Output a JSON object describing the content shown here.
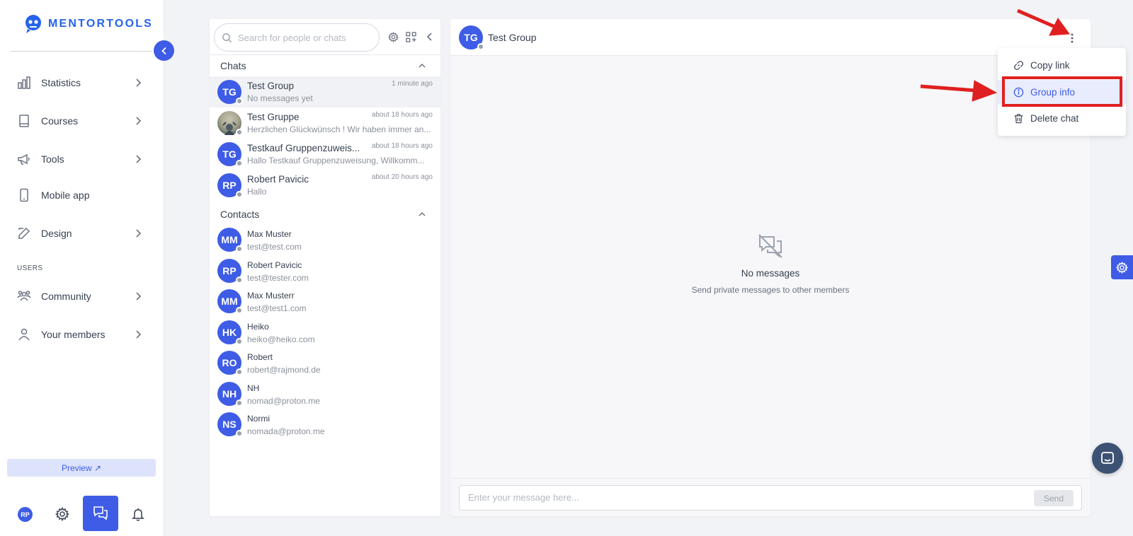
{
  "app": {
    "brand": "MENTORTOOLS"
  },
  "sidebar": {
    "items": [
      {
        "label": "Statistics",
        "icon": "bar-chart-icon"
      },
      {
        "label": "Courses",
        "icon": "book-icon"
      },
      {
        "label": "Tools",
        "icon": "megaphone-icon"
      },
      {
        "label": "Mobile app",
        "icon": "phone-icon"
      },
      {
        "label": "Design",
        "icon": "pencil-icon"
      }
    ],
    "users_section": "USERS",
    "user_items": [
      {
        "label": "Community",
        "icon": "people-icon"
      },
      {
        "label": "Your members",
        "icon": "user-icon"
      }
    ],
    "preview_label": "Preview ↗",
    "user_initials": "RP"
  },
  "chat_list": {
    "search_placeholder": "Search for people or chats",
    "chats_header": "Chats",
    "contacts_header": "Contacts",
    "chats": [
      {
        "initials": "TG",
        "name": "Test Group",
        "preview": "No messages yet",
        "time": "1 minute ago"
      },
      {
        "initials": "",
        "name": "Test Gruppe",
        "preview": "Herzlichen Glückwünsch ! Wir haben immer an...",
        "time": "about 18 hours ago"
      },
      {
        "initials": "TG",
        "name": "Testkauf Gruppenzuweis...",
        "preview": "Hallo Testkauf Gruppenzuweisung, Willkomm...",
        "time": "about 18 hours ago"
      },
      {
        "initials": "RP",
        "name": "Robert Pavicic",
        "preview": "Hallo",
        "time": "about 20 hours ago"
      }
    ],
    "contacts": [
      {
        "initials": "MM",
        "name": "Max Muster",
        "email": "test@test.com"
      },
      {
        "initials": "RP",
        "name": "Robert Pavicic",
        "email": "test@tester.com"
      },
      {
        "initials": "MM",
        "name": "Max Musterr",
        "email": "test@test1.com"
      },
      {
        "initials": "HK",
        "name": "Heiko",
        "email": "heiko@heiko.com"
      },
      {
        "initials": "RO",
        "name": "Robert",
        "email": "robert@rajmond.de"
      },
      {
        "initials": "NH",
        "name": "NH",
        "email": "nomad@proton.me"
      },
      {
        "initials": "NS",
        "name": "Normi",
        "email": "nomada@proton.me"
      }
    ]
  },
  "conversation": {
    "initials": "TG",
    "title": "Test Group",
    "empty_title": "No messages",
    "empty_subtitle": "Send private messages to other members",
    "input_placeholder": "Enter your message here...",
    "send_label": "Send"
  },
  "menu": {
    "items": [
      {
        "label": "Copy link",
        "icon": "link-icon"
      },
      {
        "label": "Group info",
        "icon": "info-icon"
      },
      {
        "label": "Delete chat",
        "icon": "trash-icon"
      }
    ]
  },
  "colors": {
    "accent": "#3e5ce6",
    "annotation_red": "#e02020",
    "highlight_bg": "#e8ecfc"
  }
}
